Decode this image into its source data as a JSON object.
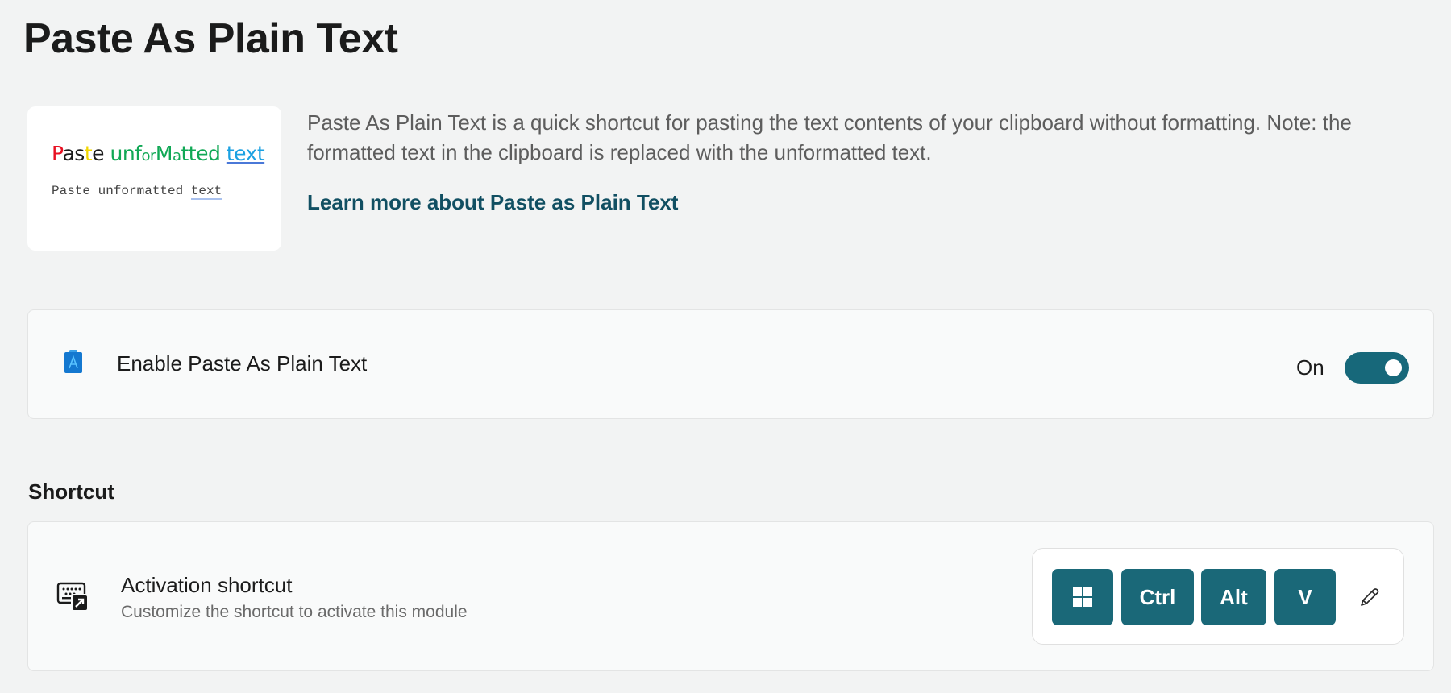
{
  "page": {
    "title": "Paste As Plain Text"
  },
  "hero": {
    "rich_text": {
      "p": "P",
      "a": "a",
      "s": "s",
      "t": "t",
      "e": "e",
      "word2_part1": "unf",
      "word2_or": "or",
      "word2_m": "M",
      "word2_a": "a",
      "word2_rest": "tted",
      "word3": "text"
    },
    "plain_text_main": "Paste unformatted ",
    "plain_text_selected": "text"
  },
  "description": {
    "text": "Paste As Plain Text is a quick shortcut for pasting the text contents of your clipboard without formatting. Note: the formatted text in the clipboard is replaced with the unformatted text.",
    "learn_more_link": "Learn more about Paste as Plain Text"
  },
  "enable_card": {
    "icon": "clipboard-a-icon",
    "label": "Enable Paste As Plain Text",
    "toggle_state_label": "On",
    "toggle_on": true
  },
  "shortcut_section": {
    "heading": "Shortcut",
    "icon": "keyboard-shortcut-icon",
    "title": "Activation shortcut",
    "subtitle": "Customize the shortcut to activate this module",
    "keys": [
      {
        "label": "",
        "icon": "windows-key-icon"
      },
      {
        "label": "Ctrl"
      },
      {
        "label": "Alt"
      },
      {
        "label": "V"
      }
    ],
    "edit_icon": "pencil-icon"
  },
  "colors": {
    "accent": "#17687a",
    "link": "#114f62",
    "background": "#f2f3f3",
    "card": "#f9fafa"
  }
}
